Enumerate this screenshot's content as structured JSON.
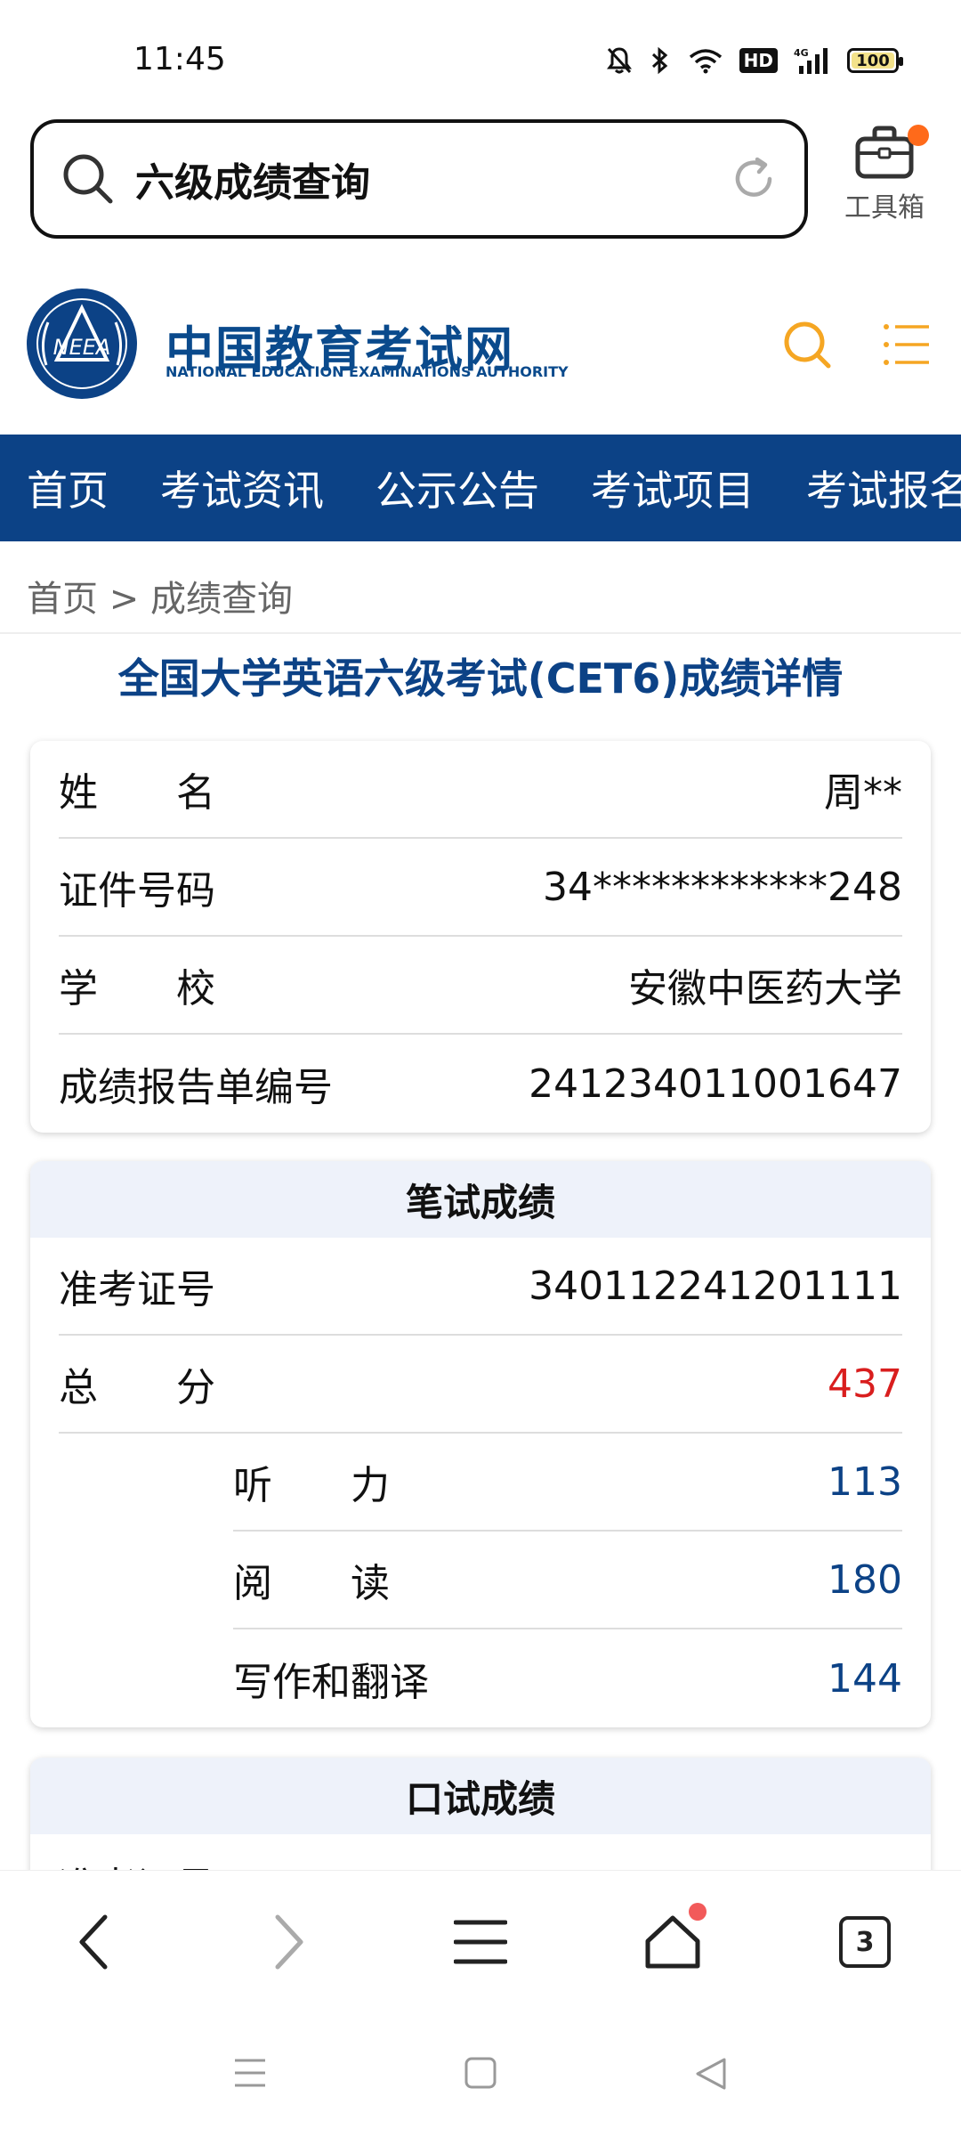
{
  "status_bar": {
    "time": "11:45",
    "network": "4G",
    "hd": "HD",
    "battery": "100"
  },
  "search": {
    "query": "六级成绩查询"
  },
  "toolbox": {
    "label": "工具箱"
  },
  "site": {
    "logo_text": "NEEA",
    "name_cn": "中国教育考试网",
    "name_en": "NATIONAL EDUCATION EXAMINATIONS AUTHORITY"
  },
  "nav": {
    "items": [
      "首页",
      "考试资讯",
      "公示公告",
      "考试项目",
      "考试报名"
    ]
  },
  "breadcrumb": "首页 > 成绩查询",
  "page_title": "全国大学英语六级考试(CET6)成绩详情",
  "personal": {
    "rows": [
      {
        "label": "姓　　名",
        "value": "周**"
      },
      {
        "label": "证件号码",
        "value": "34************248"
      },
      {
        "label": "学　　校",
        "value": "安徽中医药大学"
      },
      {
        "label": "成绩报告单编号",
        "value": "241234011001647"
      }
    ]
  },
  "written": {
    "title": "笔试成绩",
    "ticket_label": "准考证号",
    "ticket_value": "340112241201111",
    "total_label": "总　　分",
    "total_value": "437",
    "subs": [
      {
        "label": "听　　力",
        "value": "113"
      },
      {
        "label": "阅　　读",
        "value": "180"
      },
      {
        "label": "写作和翻译",
        "value": "144"
      }
    ]
  },
  "oral": {
    "title": "口试成绩",
    "ticket_label": "准考证号"
  },
  "bottom_bar": {
    "tab_count": "3"
  },
  "colors": {
    "brand_blue": "#0c4286",
    "total_red": "#d91e1e",
    "accent_orange": "#f5a623"
  }
}
